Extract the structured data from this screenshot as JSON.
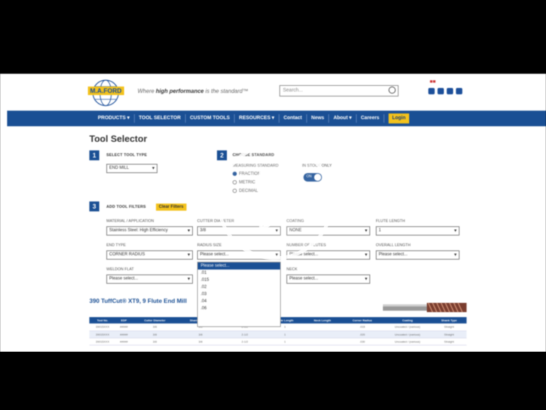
{
  "header": {
    "logo_text": "M.A.FORD",
    "tagline_prefix": "Where ",
    "tagline_bold": "high performance",
    "tagline_suffix": " is the standard™",
    "search_placeholder": "Search...",
    "social_icons": [
      "facebook-icon",
      "instagram-icon",
      "twitter-icon",
      "youtube-icon"
    ]
  },
  "nav": {
    "items": [
      "PRODUCTS ▾",
      "TOOL SELECTOR",
      "CUSTOM TOOLS",
      "RESOURCES ▾",
      "Contact",
      "News",
      "About ▾",
      "Careers"
    ],
    "login": "Login"
  },
  "page_title": "Tool Selector",
  "step1": {
    "num": "1",
    "label": "SELECT TOOL TYPE",
    "value": "END MILL"
  },
  "step2": {
    "num": "2",
    "label": "CHOOSE STANDARD",
    "standard_label": "MEASURING STANDARD",
    "options": [
      "FRACTION",
      "METRIC",
      "DECIMAL"
    ],
    "in_stock_label": "IN STOCK ONLY",
    "toggle_text": "ON"
  },
  "step3": {
    "num": "3",
    "label": "ADD TOOL FILTERS",
    "clear": "Clear Filters"
  },
  "filters": {
    "material_label": "MATERIAL / APPLICATION",
    "material_value": "Stainless Steel: High Efficiency",
    "cutter_label": "CUTTER DIAMETER",
    "cutter_value": "3/8",
    "coating_label": "COATING",
    "coating_value": "NONE",
    "flute_length_label": "FLUTE LENGTH",
    "flute_length_value": "1",
    "end_type_label": "END TYPE",
    "end_type_value": "CORNER RADIUS",
    "radius_label": "RADIUS SIZE",
    "radius_value": "Please select...",
    "flutes_label": "NUMBER OF FLUTES",
    "flutes_value": "Please select...",
    "overall_label": "OVERALL LENGTH",
    "overall_value": "Please select...",
    "weldon_label": "WELDON FLAT",
    "weldon_value": "Please select...",
    "neck_label": "NECK",
    "neck_value": "Please select..."
  },
  "dropdown": [
    "Please select...",
    ".01",
    ".015",
    ".02",
    ".03",
    ".04",
    ".06"
  ],
  "product_title": "390 TuffCut® XT9, 9 Flute End Mill",
  "table": {
    "headers": [
      "Tool No.",
      "EDP",
      "Cutter Diameter",
      "Shank Diameter",
      "Overall Length",
      "Flute Length",
      "Neck Length",
      "Corner Radius",
      "Coating",
      "Shank Type"
    ],
    "rows": [
      [
        "39015XXX",
        "#####",
        "3/8",
        "3/8",
        "2-1/2",
        "1",
        "",
        ".015",
        "Uncoated / (various)",
        "Straight"
      ],
      [
        "39015XXX",
        "#####",
        "3/8",
        "3/8",
        "2-1/2",
        "1",
        "",
        ".020",
        "Uncoated / (various)",
        "Straight"
      ],
      [
        "39015XXX",
        "#####",
        "3/8",
        "3/8",
        "2-1/2",
        "1",
        "",
        ".030",
        "Uncoated / (various)",
        "Straight"
      ]
    ]
  },
  "colors": {
    "brand_blue": "#1a4f94",
    "accent_yellow": "#f3c21b"
  }
}
